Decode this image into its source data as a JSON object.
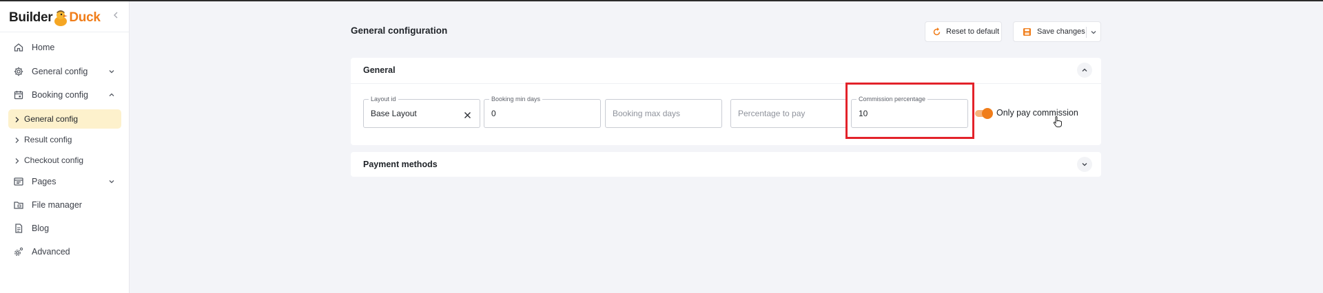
{
  "app": {
    "logo_part1": "Builder",
    "logo_part2": "Duck"
  },
  "sidebar": {
    "items": [
      {
        "label": "Home",
        "icon": "home-icon"
      },
      {
        "label": "General config",
        "icon": "gear-icon"
      },
      {
        "label": "Booking config",
        "icon": "calendar-icon",
        "expanded": true
      },
      {
        "label": "Pages",
        "icon": "pages-icon"
      },
      {
        "label": "File manager",
        "icon": "folder-icon"
      },
      {
        "label": "Blog",
        "icon": "document-icon"
      },
      {
        "label": "Advanced",
        "icon": "advanced-gear-icon"
      }
    ],
    "sub_items": [
      {
        "label": "General config",
        "active": true
      },
      {
        "label": "Result config",
        "active": false
      },
      {
        "label": "Checkout config",
        "active": false
      }
    ]
  },
  "main": {
    "title": "General configuration",
    "reset_label": "Reset to default",
    "save_label": "Save changes"
  },
  "general_panel": {
    "title": "General",
    "fields": {
      "layout_id": {
        "label": "Layout id",
        "value": "Base Layout"
      },
      "booking_min_days": {
        "label": "Booking min days",
        "value": "0"
      },
      "booking_max_days": {
        "placeholder": "Booking max days"
      },
      "percentage_to_pay": {
        "placeholder": "Percentage to pay"
      },
      "commission_percentage": {
        "label": "Commission percentage",
        "value": "10"
      }
    },
    "toggle": {
      "label": "Only pay commission",
      "on": true
    }
  },
  "payment_panel": {
    "title": "Payment methods"
  },
  "colors": {
    "accent": "#f07d1a",
    "active_bg": "#fdf1cc",
    "highlight": "#e3222a"
  }
}
